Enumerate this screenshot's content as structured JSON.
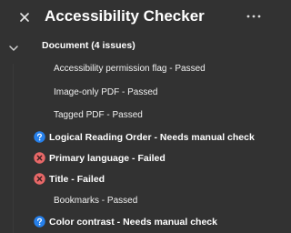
{
  "header": {
    "title": "Accessibility Checker",
    "close_icon": "close-icon",
    "more_icon": "more-options-icon"
  },
  "document_section": {
    "label": "Document (4 issues)",
    "expanded": true
  },
  "items": [
    {
      "label": "Accessibility permission flag - Passed",
      "status": "passed",
      "icon": null
    },
    {
      "label": "Image-only PDF - Passed",
      "status": "passed",
      "icon": null
    },
    {
      "label": "Tagged PDF - Passed",
      "status": "passed",
      "icon": null
    },
    {
      "label": "Logical Reading Order - Needs manual check",
      "status": "manual",
      "icon": "question-icon"
    },
    {
      "label": "Primary language - Failed",
      "status": "failed",
      "icon": "failed-icon"
    },
    {
      "label": "Title - Failed",
      "status": "failed",
      "icon": "failed-icon"
    },
    {
      "label": "Bookmarks - Passed",
      "status": "passed",
      "icon": null
    },
    {
      "label": "Color contrast - Needs manual check",
      "status": "manual",
      "icon": "question-icon"
    }
  ],
  "colors": {
    "background": "#323232",
    "text": "#ffffff",
    "manual_icon": "#2680eb",
    "failed_icon": "#e86868"
  }
}
